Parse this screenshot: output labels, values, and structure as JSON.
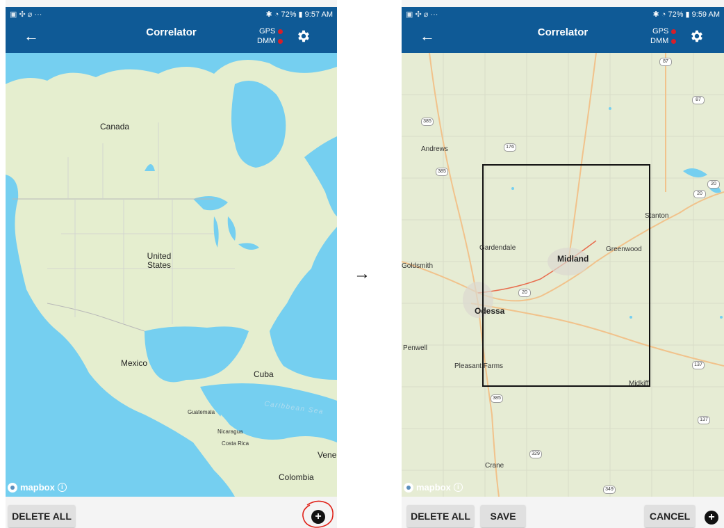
{
  "transition_arrow": "→",
  "colors": {
    "header": "#0f5a96",
    "status_dot": "#d61f2a",
    "water": "#75cff0",
    "land": "#e5eecf",
    "annotation_circle": "#e0231a"
  },
  "left_screen": {
    "status_bar": {
      "icons_left": "▣ ✣ ⌀ ···",
      "right": "✱ ◔ 72% ▮ 9:57 AM"
    },
    "header": {
      "back_icon": "←",
      "title": "Correlator",
      "gps_label": "GPS",
      "dmm_label": "DMM",
      "settings_icon": "gear-icon"
    },
    "map_labels": {
      "canada": "Canada",
      "united_states": "United States",
      "mexico": "Mexico",
      "cuba": "Cuba",
      "caribbean_sea": "Caribbean Sea",
      "guatemala": "Guatemala",
      "nicaragua": "Nicaragua",
      "costa_rica": "Costa Rica",
      "venezuela": "Vene",
      "colombia": "Colombia"
    },
    "attribution": {
      "logo_text": "mapbox",
      "info_icon": "i"
    },
    "bottom_bar": {
      "delete_all": "DELETE ALL",
      "add_icon": "+"
    }
  },
  "right_screen": {
    "status_bar": {
      "icons_left": "▣ ✣ ⌀ ···",
      "right": "✱ ◔ 72% ▮ 9:59 AM"
    },
    "header": {
      "back_icon": "←",
      "title": "Correlator",
      "gps_label": "GPS",
      "dmm_label": "DMM",
      "settings_icon": "gear-icon"
    },
    "map_labels": {
      "andrews": "Andrews",
      "goldsmith": "Goldsmith",
      "gardendale": "Gardendale",
      "midland": "Midland",
      "greenwood": "Greenwood",
      "stanton": "Stanton",
      "odessa": "Odessa",
      "penwell": "Penwell",
      "pleasant_farms": "Pleasant Farms",
      "midkiff": "Midkiff",
      "crane": "Crane"
    },
    "road_shields": [
      "87",
      "87",
      "385",
      "176",
      "385",
      "20",
      "20",
      "20",
      "137",
      "385",
      "137",
      "329",
      "349"
    ],
    "attribution": {
      "logo_text": "mapbox",
      "info_icon": "i"
    },
    "bottom_bar": {
      "delete_all": "DELETE ALL",
      "save": "SAVE",
      "cancel": "CANCEL",
      "add_icon": "+"
    }
  }
}
